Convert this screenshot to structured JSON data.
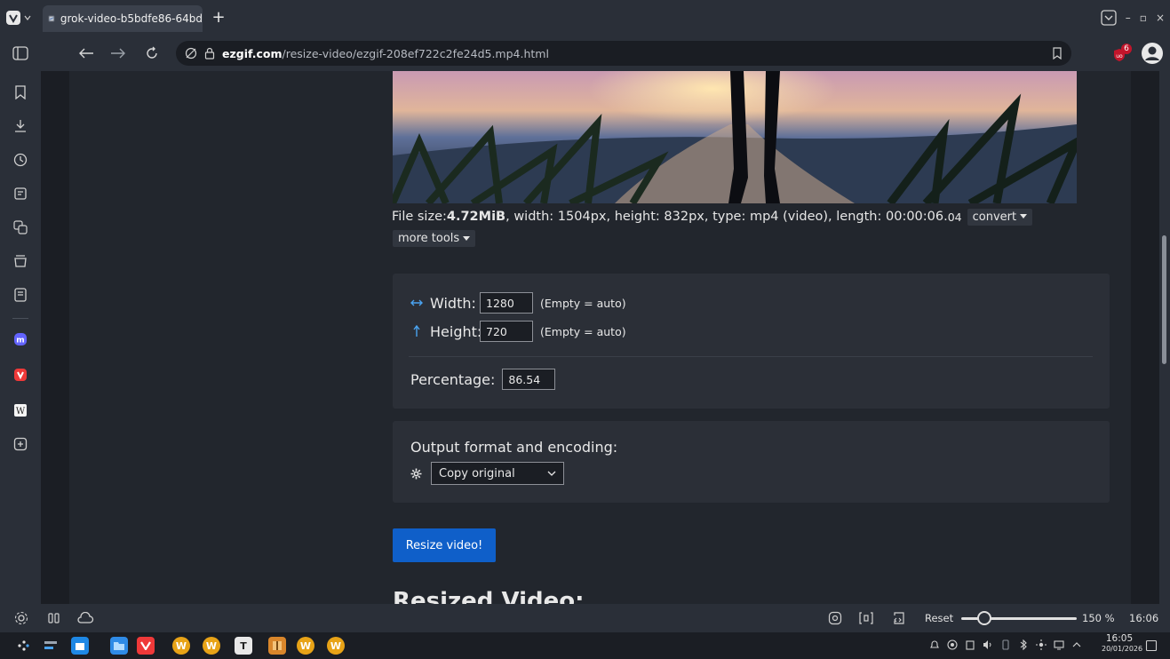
{
  "colors": {
    "chrome": "#2a2f38",
    "page_bg": "#1b1e24",
    "content_bg": "#22262d",
    "panel_bg": "#2b2f37",
    "accent_blue": "#0f5fc9",
    "vivaldi_red": "#ef3939",
    "ublock_red": "#c2152b"
  },
  "tab": {
    "title": "grok-video-b5bdfe86-64bd"
  },
  "address": {
    "host": "ezgif.com",
    "path": "/resize-video/ezgif-208ef722c2fe24d5.mp4.html"
  },
  "extensions": {
    "ublock_badge": "6"
  },
  "file_info": {
    "prefix": "File size: ",
    "size": "4.72MiB",
    "details": ", width: 1504px, height: 832px, type: mp4 (video), length: 00:00:06.",
    "length_ms": "04",
    "convert_label": "convert",
    "more_tools_label": "more tools"
  },
  "dimensions": {
    "width_label": "Width:",
    "width_value": "1280",
    "width_hint": "(Empty = auto)",
    "height_label": "Height:",
    "height_value": "720",
    "height_hint": "(Empty = auto)",
    "percentage_label": "Percentage:",
    "percentage_value": "86.54"
  },
  "output": {
    "label": "Output format and encoding:",
    "selected": "Copy original"
  },
  "resize_button": "Resize video!",
  "resized_heading": "Resized Video:",
  "statusbar": {
    "reset_label": "Reset",
    "zoom": "150 %",
    "zoom_level": 0.2,
    "clock": "16:06"
  },
  "taskbar": {
    "time": "16:05",
    "date": "20/01/2026"
  }
}
